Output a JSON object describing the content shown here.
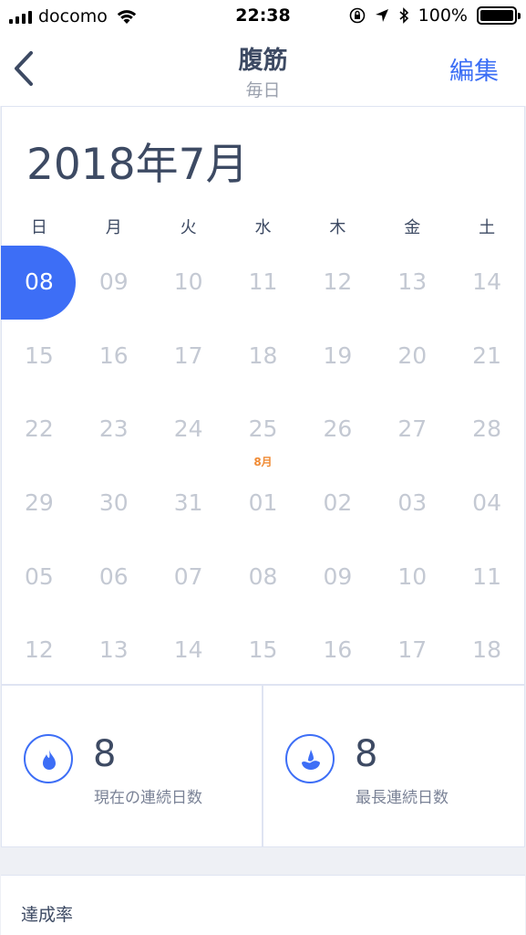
{
  "status_bar": {
    "carrier": "docomo",
    "time": "22:38",
    "battery": "100%"
  },
  "nav": {
    "title": "腹筋",
    "subtitle": "毎日",
    "edit_label": "編集"
  },
  "calendar": {
    "month_title": "2018年7月",
    "weekdays": [
      "日",
      "月",
      "火",
      "水",
      "木",
      "金",
      "土"
    ],
    "weeks": [
      [
        "08",
        "09",
        "10",
        "11",
        "12",
        "13",
        "14"
      ],
      [
        "15",
        "16",
        "17",
        "18",
        "19",
        "20",
        "21"
      ],
      [
        "22",
        "23",
        "24",
        "25",
        "26",
        "27",
        "28"
      ],
      [
        "29",
        "30",
        "31",
        "01",
        "02",
        "03",
        "04"
      ],
      [
        "05",
        "06",
        "07",
        "08",
        "09",
        "10",
        "11"
      ],
      [
        "12",
        "13",
        "14",
        "15",
        "16",
        "17",
        "18"
      ]
    ],
    "month_marker": "8月",
    "accent_color": "#3d6ef6",
    "marker_color": "#f08a33"
  },
  "stats": {
    "current": {
      "value": "8",
      "label": "現在の連続日数",
      "icon": "flame-icon"
    },
    "longest": {
      "value": "8",
      "label": "最長連続日数",
      "icon": "water-drop-icon"
    }
  },
  "rate": {
    "title": "達成率"
  }
}
